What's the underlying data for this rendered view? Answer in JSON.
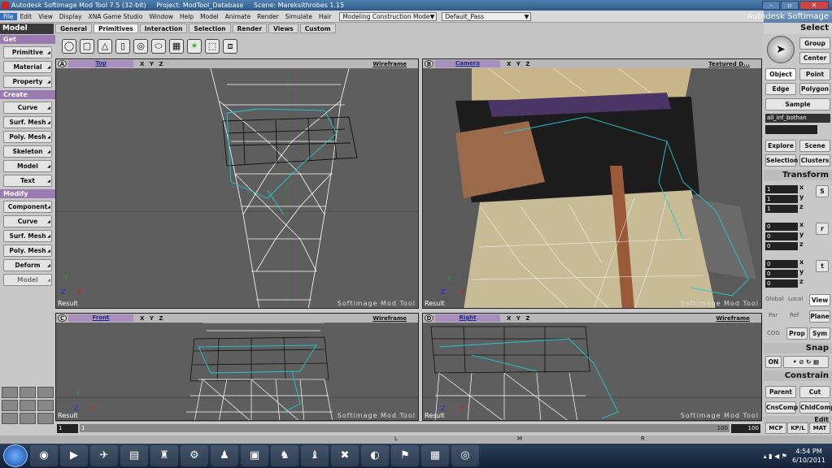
{
  "titlebar": {
    "parts": [
      "Autodesk Softimage Mod Tool 7.5 (32-bit)",
      "Project: ModTool_Database",
      "Scene: Mareksithrobes 1.15"
    ],
    "buttons": [
      "–",
      "▫",
      "✕"
    ]
  },
  "menu": {
    "items": [
      "File",
      "Edit",
      "View",
      "Display",
      "XNA Game Studio",
      "Window",
      "Help",
      "Model",
      "Animate",
      "Render",
      "Simulate",
      "Hair"
    ],
    "construction_mode": "Modeling Construction Mode",
    "pass": "Default_Pass",
    "brand": "Autodesk Softimage"
  },
  "module": {
    "name": "Model",
    "tabs": [
      "General",
      "Primitives",
      "Interaction",
      "Selection",
      "Render",
      "Views",
      "Custom"
    ],
    "active_tab": "Primitives"
  },
  "toolbar": {
    "icons": [
      "sphere-icon",
      "cube-icon",
      "cone-icon",
      "cylinder-icon",
      "torus-icon",
      "disc-icon",
      "grid-icon",
      "null-icon",
      "cube-wire-icon",
      "cube-3d-icon"
    ]
  },
  "left_panel": {
    "sections": [
      {
        "title": "Get",
        "buttons": [
          "Primitive",
          "Material",
          "Property"
        ]
      },
      {
        "title": "Create",
        "buttons": [
          "Curve",
          "Surf. Mesh",
          "Poly. Mesh",
          "Skeleton",
          "Model",
          "Text"
        ]
      },
      {
        "title": "Modify",
        "buttons": [
          "Component",
          "Curve",
          "Surf. Mesh",
          "Poly. Mesh",
          "Deform",
          "Model"
        ]
      }
    ]
  },
  "viewports": [
    {
      "letter": "A",
      "camera": "Top",
      "mode": "Wireframe",
      "label": "Result",
      "watermark": "Softimage Mod Tool"
    },
    {
      "letter": "B",
      "camera": "Camera",
      "mode": "Textured D...",
      "label": "Result",
      "watermark": "Softimage Mod Tool"
    },
    {
      "letter": "C",
      "camera": "Front",
      "mode": "Wireframe",
      "label": "Result",
      "watermark": "Softimage Mod Tool"
    },
    {
      "letter": "D",
      "camera": "Right",
      "mode": "Wireframe",
      "label": "Result",
      "watermark": "Softimage Mod Tool"
    }
  ],
  "viewport_axes": "X Y Z",
  "right_panel": {
    "select_header": "Select",
    "group": "Group",
    "center": "Center",
    "object": "Object",
    "point": "Point",
    "edge": "Edge",
    "polygon": "Polygon",
    "sample": "Sample",
    "selection_name": "all_inf_bothan",
    "explore": "Explore",
    "scene": "Scene",
    "selection": "Selection",
    "clusters": "Clusters",
    "transform_header": "Transform",
    "scale": [
      "1",
      "1",
      "1"
    ],
    "rotate": [
      "0",
      "0",
      "0"
    ],
    "translate": [
      "0",
      "0",
      "0"
    ],
    "axes": [
      "x",
      "y",
      "z"
    ],
    "srt": [
      "S",
      "r",
      "t"
    ],
    "ref": [
      "Global",
      "Local",
      "View",
      "Par",
      "Ref",
      "Plane"
    ],
    "cog": "COG",
    "prop": "Prop",
    "sym": "Sym",
    "snap_header": "Snap",
    "snap_on": "ON",
    "constrain_header": "Constrain",
    "parent": "Parent",
    "cut": "Cut",
    "cnscomp": "CnsComp",
    "chldcomp": "ChldComp",
    "edit": "Edit",
    "mcp": [
      "MCP",
      "KP/L",
      "MAT"
    ]
  },
  "timeline": {
    "start": "1",
    "current": "1",
    "end_left": "100",
    "end_right": "100"
  },
  "bottom_tabs": [
    "L",
    "M",
    "R"
  ],
  "taskbar": {
    "time": "4:54 PM",
    "date": "6/10/2011"
  },
  "colors": {
    "accent": "#9a7ab0",
    "wire": "#ffffff",
    "selected": "#22c8c8",
    "viewport_bg": "#5e5e5e"
  }
}
